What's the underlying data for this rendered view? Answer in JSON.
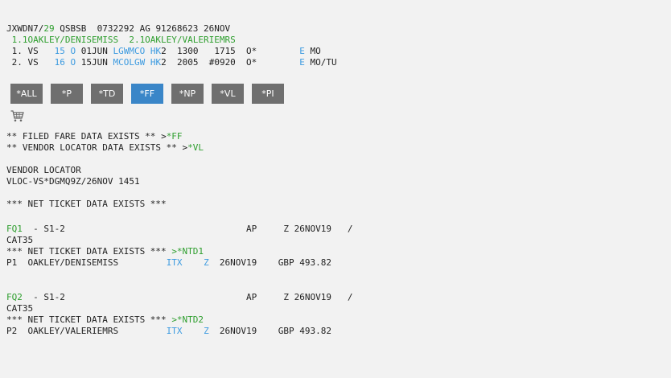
{
  "pnr": {
    "header": {
      "a": "JXWDN7/",
      "b": "29",
      "c": " QSBSB  0732292 AG 91268623 26NOV"
    },
    "names": " 1.1OAKLEY/DENISEMISS  2.1OAKLEY/VALERIEMRS",
    "segments": [
      {
        "p1": " 1. VS   ",
        "fl": "15 O",
        "p2": " 01JUN ",
        "city": "LGWMCO",
        "p3": " ",
        "st": "HK",
        "p4": "2  1300   1715  O*        ",
        "e": "E",
        "p5": " MO"
      },
      {
        "p1": " 2. VS   ",
        "fl": "16 O",
        "p2": " 15JUN ",
        "city": "MCOLGW",
        "p3": " ",
        "st": "HK",
        "p4": "2  2005  #0920  O*        ",
        "e": "E",
        "p5": " MO/TU"
      }
    ]
  },
  "buttons": [
    "*ALL",
    "*P",
    "*TD",
    "*FF",
    "*NP",
    "*VL",
    "*PI"
  ],
  "active_button": "*FF",
  "icons": {
    "cart": "shopping-cart-icon"
  },
  "notices": {
    "filed": {
      "text": "** FILED FARE DATA EXISTS ** ",
      "arrow": ">",
      "link": "*FF"
    },
    "vendor": {
      "text": "** VENDOR LOCATOR DATA EXISTS ** ",
      "arrow": ">",
      "link": "*VL"
    }
  },
  "vendor_locator": {
    "title": "VENDOR LOCATOR",
    "value": "VLOC-VS*DGMQ9Z/26NOV 1451"
  },
  "net_ticket_header": "*** NET TICKET DATA EXISTS ***",
  "fares": [
    {
      "fq": "FQ1",
      "line1": "  - S1-2                                  AP     Z 26NOV19   /",
      "cat": "CAT35",
      "net_text": "*** NET TICKET DATA EXISTS *** ",
      "net_link": ">*NTD1",
      "pax": "P1  OAKLEY/DENISEMISS         ",
      "itx": "ITX",
      "mid": "    ",
      "z": "Z",
      "tail": "  26NOV19    GBP 493.82"
    },
    {
      "fq": "FQ2",
      "line1": "  - S1-2                                  AP     Z 26NOV19   /",
      "cat": "CAT35",
      "net_text": "*** NET TICKET DATA EXISTS *** ",
      "net_link": ">*NTD2",
      "pax": "P2  OAKLEY/VALERIEMRS         ",
      "itx": "ITX",
      "mid": "    ",
      "z": "Z",
      "tail": "  26NOV19    GBP 493.82"
    }
  ]
}
